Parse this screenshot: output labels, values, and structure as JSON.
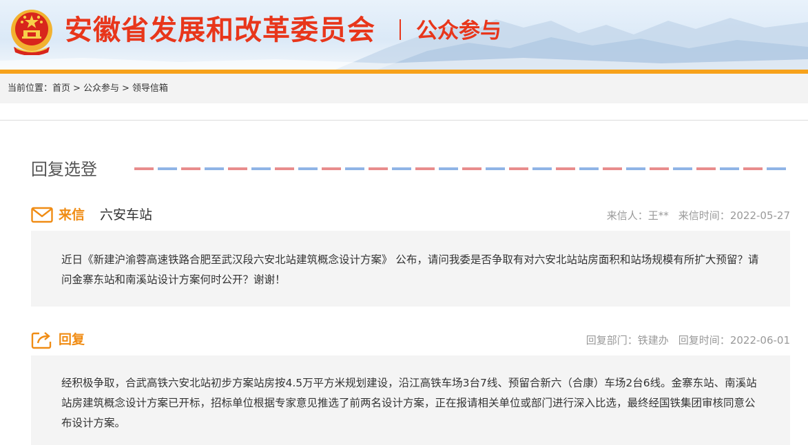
{
  "header": {
    "site_title": "安徽省发展和改革委员会",
    "section_name": "公众参与",
    "accent_color": "#e8361b",
    "bar_color": "#f7a21b"
  },
  "breadcrumb": {
    "prefix": "当前位置：",
    "items": [
      "首页",
      "公众参与",
      "领导信箱"
    ],
    "separator": ">"
  },
  "page": {
    "heading": "回复选登"
  },
  "letter": {
    "tag": "来信",
    "icon": "envelope-icon",
    "subject": "六安车站",
    "sender_label": "来信人：",
    "sender": "王**",
    "time_label": "来信时间：",
    "time": "2022-05-27",
    "body": "近日《新建沪渝蓉高速铁路合肥至武汉段六安北站建筑概念设计方案》 公布，请问我委是否争取有对六安北站站房面积和站场规模有所扩大预留？请问金寨东站和南溪站设计方案何时公开？谢谢！"
  },
  "reply": {
    "tag": "回复",
    "icon": "reply-share-icon",
    "dept_label": "回复部门：",
    "dept": "铁建办",
    "time_label": "回复时间：",
    "time": "2022-06-01",
    "body": "经积极争取，合武高铁六安北站初步方案站房按4.5万平方米规划建设，沿江高铁车场3台7线、预留合新六（合康）车场2台6线。金寨东站、南溪站站房建筑概念设计方案已开标，招标单位根据专家意见推选了前两名设计方案，正在报请相关单位或部门进行深入比选，最终经国铁集团审核同意公布设计方案。"
  }
}
